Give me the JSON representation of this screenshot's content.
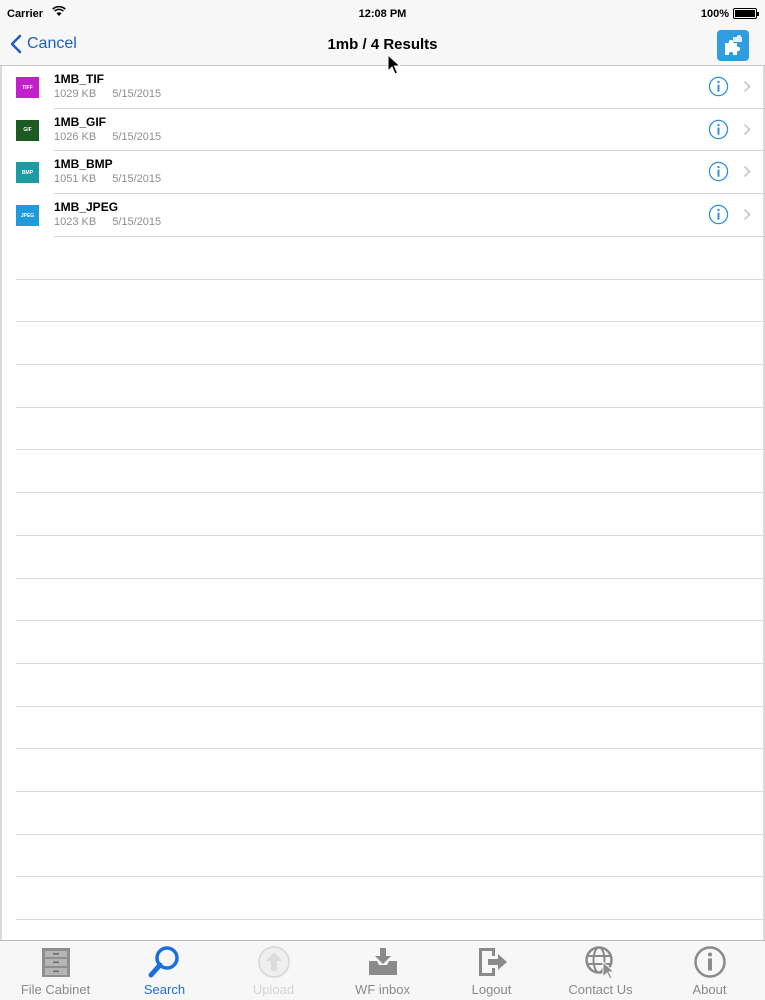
{
  "status_bar": {
    "carrier": "Carrier",
    "time": "12:08 PM",
    "battery": "100%"
  },
  "nav": {
    "back_label": "Cancel",
    "title": "1mb / 4 Results",
    "action_icon": "puzzle-icon"
  },
  "results": [
    {
      "name": "1MB_TIF",
      "size": "1029 KB",
      "date": "5/15/2015",
      "icon_label": "TIFF",
      "icon_color": "#c21ec9"
    },
    {
      "name": "1MB_GIF",
      "size": "1026 KB",
      "date": "5/15/2015",
      "icon_label": "GIF",
      "icon_color": "#1c5a23"
    },
    {
      "name": "1MB_BMP",
      "size": "1051 KB",
      "date": "5/15/2015",
      "icon_label": "BMP",
      "icon_color": "#1c9ba3"
    },
    {
      "name": "1MB_JPEG",
      "size": "1023 KB",
      "date": "5/15/2015",
      "icon_label": "JPEG",
      "icon_color": "#1f9bdc"
    }
  ],
  "tabs": [
    {
      "label": "File Cabinet",
      "icon": "file-cabinet-icon",
      "state": "normal"
    },
    {
      "label": "Search",
      "icon": "search-icon",
      "state": "active"
    },
    {
      "label": "Upload",
      "icon": "upload-icon",
      "state": "disabled"
    },
    {
      "label": "WF inbox",
      "icon": "inbox-icon",
      "state": "normal"
    },
    {
      "label": "Logout",
      "icon": "logout-icon",
      "state": "normal"
    },
    {
      "label": "Contact Us",
      "icon": "globe-icon",
      "state": "normal"
    },
    {
      "label": "About",
      "icon": "info-icon",
      "state": "normal"
    }
  ],
  "colors": {
    "accent": "#1b6fdc",
    "action_button": "#2f9de0"
  }
}
